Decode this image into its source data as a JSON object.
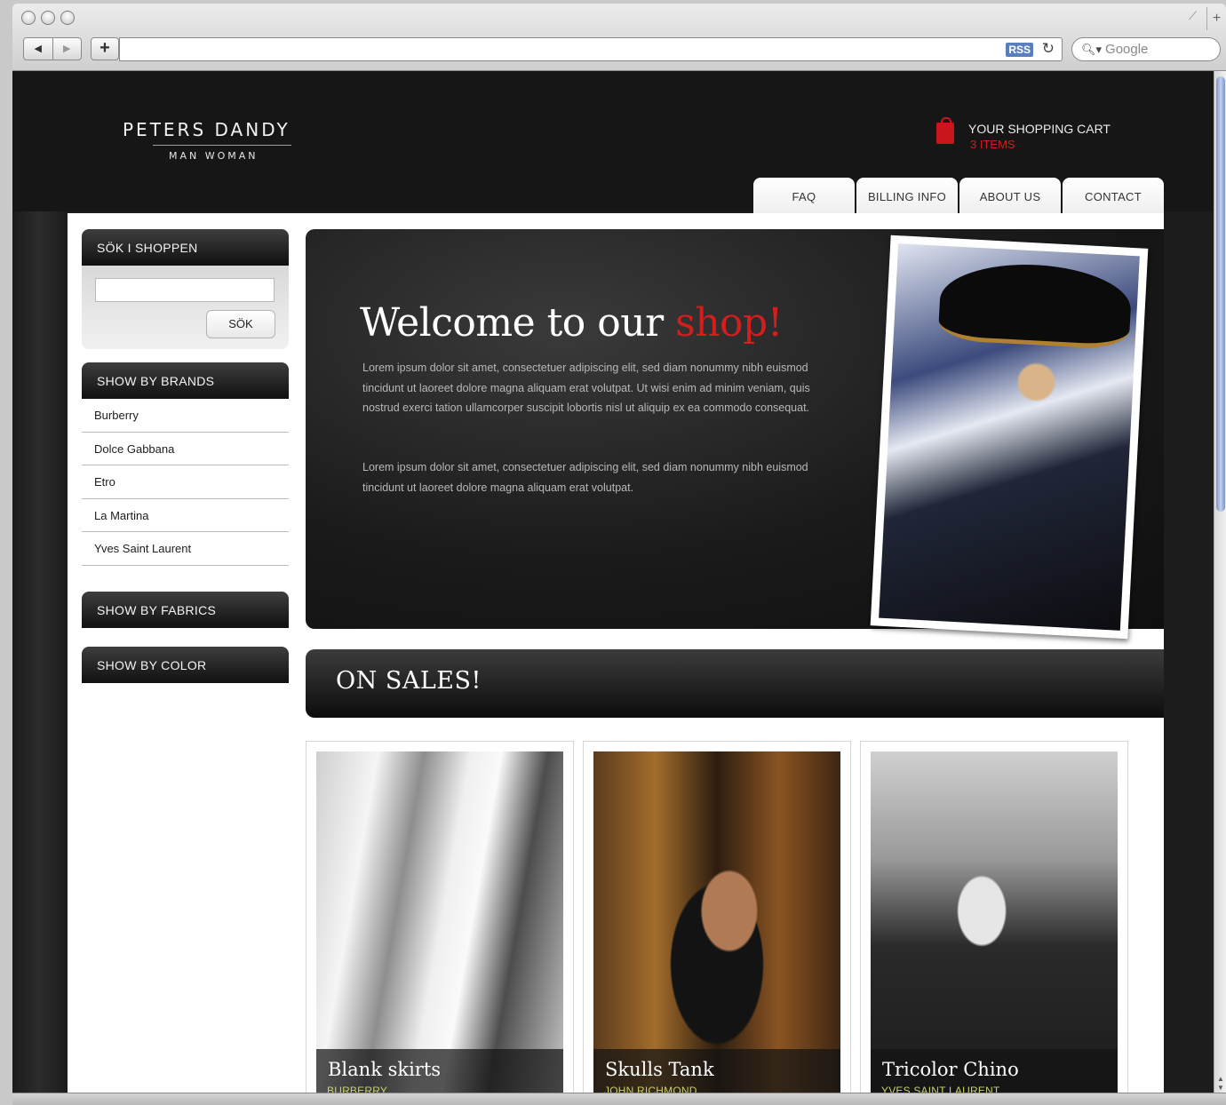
{
  "browser": {
    "rss_label": "RSS",
    "search_placeholder": "Google"
  },
  "header": {
    "logo_title": "PETERS DANDY",
    "logo_subtitle": "MAN  WOMAN",
    "cart_label": "YOUR SHOPPING CART",
    "cart_count": "3 ITEMS",
    "nav_tabs": [
      {
        "label": "FAQ"
      },
      {
        "label": "BILLING INFO"
      },
      {
        "label": "ABOUT US"
      },
      {
        "label": "CONTACT"
      }
    ]
  },
  "sidebar": {
    "search_title": "SÖK I SHOPPEN",
    "search_value": "",
    "search_button": "SÖK",
    "brands_title": "SHOW BY BRANDS",
    "brands": [
      "Burberry",
      "Dolce Gabbana",
      "Etro",
      "La Martina",
      "Yves Saint Laurent"
    ],
    "fabrics_title": "SHOW BY FABRICS",
    "color_title": "SHOW BY COLOR"
  },
  "hero": {
    "title_main": "Welcome to our ",
    "title_accent": "shop!",
    "paragraph1": "Lorem ipsum dolor sit amet, consectetuer adipiscing elit, sed diam nonummy nibh euismod tincidunt ut laoreet dolore magna aliquam erat volutpat. Ut wisi enim ad minim veniam, quis nostrud exerci tation ullamcorper suscipit lobortis nisl ut aliquip ex ea commodo consequat.",
    "paragraph2": "Lorem ipsum dolor sit amet, consectetuer adipiscing elit, sed diam nonummy nibh euismod tincidunt ut laoreet dolore magna aliquam erat volutpat."
  },
  "sales": {
    "title": "ON SALES!",
    "products": [
      {
        "name": "Blank skirts",
        "brand": "BURBERRY"
      },
      {
        "name": "Skulls Tank",
        "brand": "JOHN RICHMOND"
      },
      {
        "name": "Tricolor Chino",
        "brand": "YVES SAINT LAURENT"
      }
    ]
  },
  "colors": {
    "accent_red": "#d41d1d",
    "brand_caption": "#c9d16b",
    "background_dark": "#161616"
  }
}
